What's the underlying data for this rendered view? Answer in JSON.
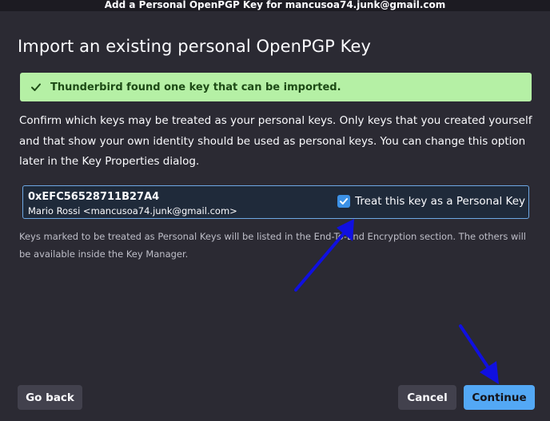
{
  "window": {
    "title": "Add a Personal OpenPGP Key for mancusoa74.junk@gmail.com"
  },
  "page": {
    "heading": "Import an existing personal OpenPGP Key"
  },
  "banner": {
    "text": "Thunderbird found one key that can be imported.",
    "icon": "check-icon",
    "color": "#b5f0a5"
  },
  "description": "Confirm which keys may be treated as your personal keys. Only keys that you created yourself and that show your own identity should be used as personal keys. You can change this option later in the Key Properties dialog.",
  "key": {
    "id": "0xEFC56528711B27A4",
    "user": "Mario Rossi <mancusoa74.junk@gmail.com>",
    "personal_label": "Treat this key as a Personal Key",
    "personal_checked": true
  },
  "note": "Keys marked to be treated as Personal Keys will be listed in the End-To-End Encryption section. The others will be available inside the Key Manager.",
  "buttons": {
    "back": "Go back",
    "cancel": "Cancel",
    "continue": "Continue"
  },
  "colors": {
    "accent": "#53a8f5",
    "annotation_arrow": "#1010e0"
  }
}
